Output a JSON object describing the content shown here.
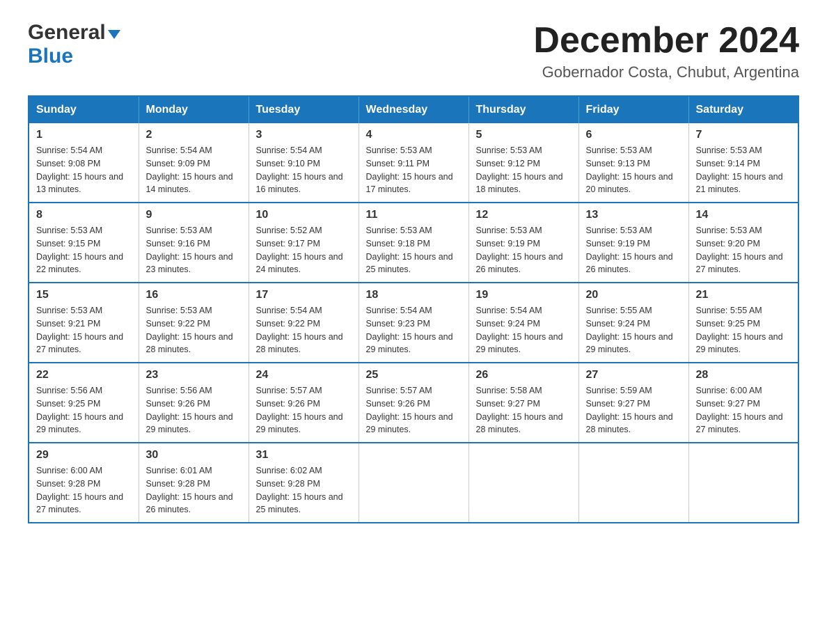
{
  "logo": {
    "general": "General",
    "blue": "Blue",
    "triangle_color": "#1a75bb"
  },
  "header": {
    "title": "December 2024",
    "subtitle": "Gobernador Costa, Chubut, Argentina"
  },
  "weekdays": [
    "Sunday",
    "Monday",
    "Tuesday",
    "Wednesday",
    "Thursday",
    "Friday",
    "Saturday"
  ],
  "weeks": [
    [
      {
        "day": "1",
        "sunrise": "5:54 AM",
        "sunset": "9:08 PM",
        "daylight": "15 hours and 13 minutes."
      },
      {
        "day": "2",
        "sunrise": "5:54 AM",
        "sunset": "9:09 PM",
        "daylight": "15 hours and 14 minutes."
      },
      {
        "day": "3",
        "sunrise": "5:54 AM",
        "sunset": "9:10 PM",
        "daylight": "15 hours and 16 minutes."
      },
      {
        "day": "4",
        "sunrise": "5:53 AM",
        "sunset": "9:11 PM",
        "daylight": "15 hours and 17 minutes."
      },
      {
        "day": "5",
        "sunrise": "5:53 AM",
        "sunset": "9:12 PM",
        "daylight": "15 hours and 18 minutes."
      },
      {
        "day": "6",
        "sunrise": "5:53 AM",
        "sunset": "9:13 PM",
        "daylight": "15 hours and 20 minutes."
      },
      {
        "day": "7",
        "sunrise": "5:53 AM",
        "sunset": "9:14 PM",
        "daylight": "15 hours and 21 minutes."
      }
    ],
    [
      {
        "day": "8",
        "sunrise": "5:53 AM",
        "sunset": "9:15 PM",
        "daylight": "15 hours and 22 minutes."
      },
      {
        "day": "9",
        "sunrise": "5:53 AM",
        "sunset": "9:16 PM",
        "daylight": "15 hours and 23 minutes."
      },
      {
        "day": "10",
        "sunrise": "5:52 AM",
        "sunset": "9:17 PM",
        "daylight": "15 hours and 24 minutes."
      },
      {
        "day": "11",
        "sunrise": "5:53 AM",
        "sunset": "9:18 PM",
        "daylight": "15 hours and 25 minutes."
      },
      {
        "day": "12",
        "sunrise": "5:53 AM",
        "sunset": "9:19 PM",
        "daylight": "15 hours and 26 minutes."
      },
      {
        "day": "13",
        "sunrise": "5:53 AM",
        "sunset": "9:19 PM",
        "daylight": "15 hours and 26 minutes."
      },
      {
        "day": "14",
        "sunrise": "5:53 AM",
        "sunset": "9:20 PM",
        "daylight": "15 hours and 27 minutes."
      }
    ],
    [
      {
        "day": "15",
        "sunrise": "5:53 AM",
        "sunset": "9:21 PM",
        "daylight": "15 hours and 27 minutes."
      },
      {
        "day": "16",
        "sunrise": "5:53 AM",
        "sunset": "9:22 PM",
        "daylight": "15 hours and 28 minutes."
      },
      {
        "day": "17",
        "sunrise": "5:54 AM",
        "sunset": "9:22 PM",
        "daylight": "15 hours and 28 minutes."
      },
      {
        "day": "18",
        "sunrise": "5:54 AM",
        "sunset": "9:23 PM",
        "daylight": "15 hours and 29 minutes."
      },
      {
        "day": "19",
        "sunrise": "5:54 AM",
        "sunset": "9:24 PM",
        "daylight": "15 hours and 29 minutes."
      },
      {
        "day": "20",
        "sunrise": "5:55 AM",
        "sunset": "9:24 PM",
        "daylight": "15 hours and 29 minutes."
      },
      {
        "day": "21",
        "sunrise": "5:55 AM",
        "sunset": "9:25 PM",
        "daylight": "15 hours and 29 minutes."
      }
    ],
    [
      {
        "day": "22",
        "sunrise": "5:56 AM",
        "sunset": "9:25 PM",
        "daylight": "15 hours and 29 minutes."
      },
      {
        "day": "23",
        "sunrise": "5:56 AM",
        "sunset": "9:26 PM",
        "daylight": "15 hours and 29 minutes."
      },
      {
        "day": "24",
        "sunrise": "5:57 AM",
        "sunset": "9:26 PM",
        "daylight": "15 hours and 29 minutes."
      },
      {
        "day": "25",
        "sunrise": "5:57 AM",
        "sunset": "9:26 PM",
        "daylight": "15 hours and 29 minutes."
      },
      {
        "day": "26",
        "sunrise": "5:58 AM",
        "sunset": "9:27 PM",
        "daylight": "15 hours and 28 minutes."
      },
      {
        "day": "27",
        "sunrise": "5:59 AM",
        "sunset": "9:27 PM",
        "daylight": "15 hours and 28 minutes."
      },
      {
        "day": "28",
        "sunrise": "6:00 AM",
        "sunset": "9:27 PM",
        "daylight": "15 hours and 27 minutes."
      }
    ],
    [
      {
        "day": "29",
        "sunrise": "6:00 AM",
        "sunset": "9:28 PM",
        "daylight": "15 hours and 27 minutes."
      },
      {
        "day": "30",
        "sunrise": "6:01 AM",
        "sunset": "9:28 PM",
        "daylight": "15 hours and 26 minutes."
      },
      {
        "day": "31",
        "sunrise": "6:02 AM",
        "sunset": "9:28 PM",
        "daylight": "15 hours and 25 minutes."
      },
      null,
      null,
      null,
      null
    ]
  ]
}
